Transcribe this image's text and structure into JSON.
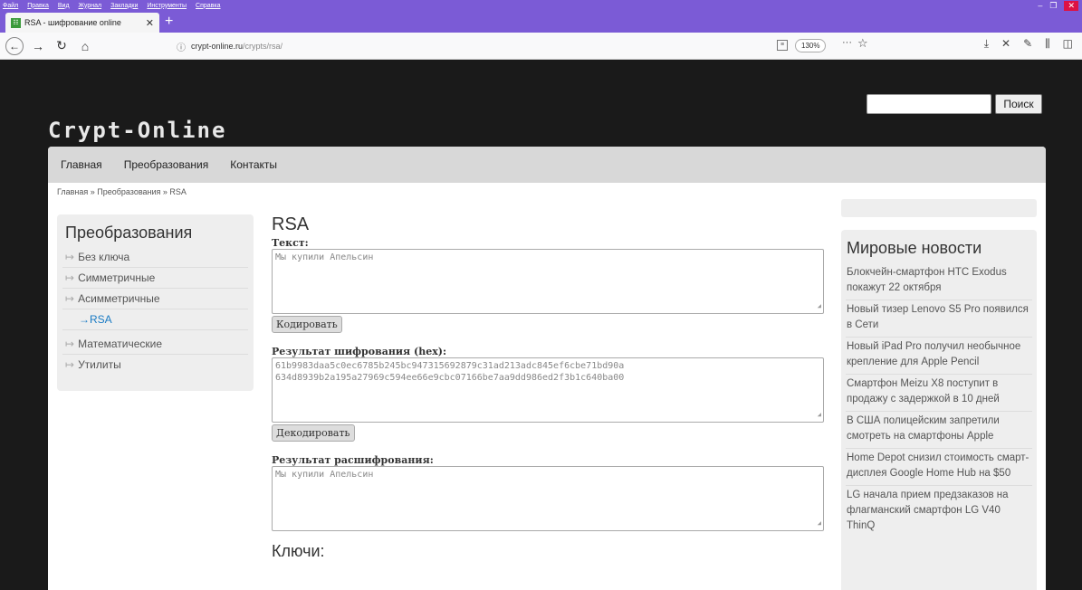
{
  "browser": {
    "menu": [
      "Файл",
      "Правка",
      "Вид",
      "Журнал",
      "Закладки",
      "Инструменты",
      "Справка"
    ],
    "tab_title": "RSA - шифрование online",
    "url_domain": "crypt-online.ru",
    "url_path": "/crypts/rsa/",
    "zoom": "130%"
  },
  "site": {
    "logo": "Crypt-Online",
    "search_button": "Поиск",
    "nav": [
      "Главная",
      "Преобразования",
      "Контакты"
    ],
    "breadcrumb": "Главная » Преобразования » RSA"
  },
  "sidebar": {
    "title": "Преобразования",
    "items": [
      {
        "label": "Без ключа"
      },
      {
        "label": "Симметричные"
      },
      {
        "label": "Асимметричные"
      },
      {
        "label": "RSA"
      },
      {
        "label": "Математические"
      },
      {
        "label": "Утилиты"
      }
    ]
  },
  "main": {
    "title": "RSA",
    "text_label": "Текст:",
    "text_value": "Мы купили Апельсин",
    "encode_button": "Кодировать",
    "encrypted_label": "Результат шифрования (hex):",
    "encrypted_line1": "61b9983daa5c0ec6785b245bc947315692879c31ad213adc845ef6cbe71bd90a",
    "encrypted_line2": "634d8939b2a195a27969c594ee66e9cbc07166be7aa9dd986ed2f3b1c640ba00",
    "decode_button": "Декодировать",
    "decrypted_label": "Результат расшифрования:",
    "decrypted_value": "Мы купили Апельсин",
    "keys_title": "Ключи:"
  },
  "news": {
    "title": "Мировые новости",
    "items": [
      "Блокчейн-смартфон HTC Exodus покажут 22 октября",
      "Новый тизер Lenovo S5 Pro появился в Сети",
      "Новый iPad Pro получил необычное крепление для Apple Pencil",
      "Смартфон Meizu X8 поступит в продажу с задержкой в 10 дней",
      "В США полицейским запретили смотреть на смартфоны Apple",
      "Home Depot снизил стоимость смарт-дисплея Google Home Hub на $50",
      "LG начала прием предзаказов на флагманский смартфон LG V40 ThinQ"
    ]
  }
}
